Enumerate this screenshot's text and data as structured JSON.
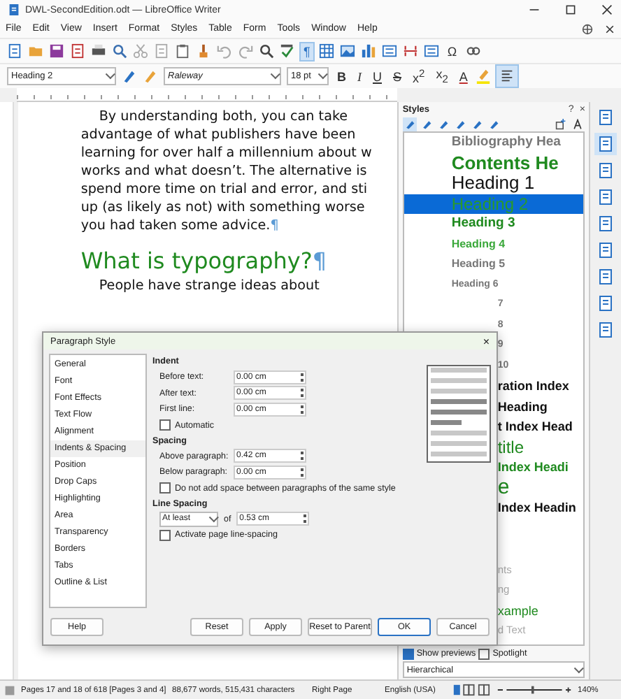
{
  "window": {
    "title": "DWL-SecondEdition.odt — LibreOffice Writer"
  },
  "menu": [
    "File",
    "Edit",
    "View",
    "Insert",
    "Format",
    "Styles",
    "Table",
    "Form",
    "Tools",
    "Window",
    "Help"
  ],
  "standard_toolbar": {
    "formatting_marks": {
      "label": "¶",
      "selected": true
    },
    "special_character": "Ω"
  },
  "formatting_toolbar": {
    "paragraph_style": "Heading 2",
    "font": "Raleway",
    "size": "18 pt",
    "buttons": [
      {
        "label": "B",
        "kind": "bold"
      },
      {
        "label": "I",
        "kind": "italic"
      },
      {
        "label": "U",
        "kind": "underline"
      },
      {
        "label": "S",
        "kind": "strike"
      },
      {
        "label": "x$^{2}$",
        "kind": "plain"
      },
      {
        "label": "x$_{2}$",
        "kind": "plain"
      },
      {
        "label": "A",
        "kind": "fontcolor"
      }
    ],
    "align_button": {
      "selected": true
    }
  },
  "document": {
    "paragraph": {
      "lines": [
        "By understanding both, you can take",
        "advantage of what publishers have been",
        "learning for over half a millennium about w",
        "works and what doesn’t. The alternative is",
        "spend more time on trial and error, and sti",
        "up (as likely as not) with something worse",
        "you had taken some advice."
      ],
      "mark": "¶"
    },
    "heading": {
      "text": "What is typography?",
      "mark": "¶"
    },
    "next_paragraph": "People have strange ideas about"
  },
  "styles_panel": {
    "title": "Styles",
    "help": "?",
    "close": "×",
    "items": [
      {
        "label": "Bibliography Hea",
        "kind": "bib",
        "selected": false
      },
      {
        "label": "Contents He",
        "kind": "contents",
        "selected": false
      },
      {
        "label": "Heading 1",
        "kind": "h1",
        "selected": false
      },
      {
        "label": "Heading 2",
        "kind": "h2",
        "selected": true
      },
      {
        "label": "Heading 3",
        "kind": "h3",
        "selected": false
      },
      {
        "label": "Heading 4",
        "kind": "h4",
        "selected": false
      },
      {
        "label": "Heading 5",
        "kind": "h5",
        "selected": false
      },
      {
        "label": "Heading 6",
        "kind": "h6",
        "selected": false
      }
    ],
    "items_behind_dialog": [
      {
        "label": "7",
        "kind": "h6"
      },
      {
        "label": "8",
        "kind": "h6"
      },
      {
        "label": "9",
        "kind": "h6"
      },
      {
        "label": "10",
        "kind": "h6"
      },
      {
        "label": "ration Index",
        "kind": "black"
      },
      {
        "label": "Heading",
        "kind": "black"
      },
      {
        "label": "t Index Head",
        "kind": "black"
      },
      {
        "label": "title",
        "kind": "subtitle"
      },
      {
        "label": "Index Headi",
        "kind": "greenbold"
      },
      {
        "label": "e",
        "kind": "title"
      },
      {
        "label": "Index Headin",
        "kind": "black"
      },
      {
        "label": "nts",
        "kind": "faint-after-gap"
      },
      {
        "label": "ng",
        "kind": "faint"
      },
      {
        "label": "xample",
        "kind": "example"
      },
      {
        "label": "d Text",
        "kind": "faint"
      }
    ],
    "show_previews": {
      "label": "Show previews",
      "checked": true
    },
    "spotlight": {
      "label": "Spotlight",
      "checked": false
    },
    "filter": "Hierarchical"
  },
  "sidebar_tabs": [
    {
      "selected": false
    },
    {
      "selected": true
    },
    {
      "selected": false
    },
    {
      "selected": false
    },
    {
      "selected": false
    },
    {
      "selected": false
    },
    {
      "selected": false
    },
    {
      "selected": false
    },
    {
      "selected": false
    }
  ],
  "dialog": {
    "title": "Paragraph Style",
    "close": "×",
    "nav": [
      {
        "label": "General",
        "selected": false
      },
      {
        "label": "Font",
        "selected": false
      },
      {
        "label": "Font Effects",
        "selected": false
      },
      {
        "label": "Text Flow",
        "selected": false
      },
      {
        "label": "Alignment",
        "selected": false
      },
      {
        "label": "Indents & Spacing",
        "selected": true
      },
      {
        "label": "Position",
        "selected": false
      },
      {
        "label": "Drop Caps",
        "selected": false
      },
      {
        "label": "Highlighting",
        "selected": false
      },
      {
        "label": "Area",
        "selected": false
      },
      {
        "label": "Transparency",
        "selected": false
      },
      {
        "label": "Borders",
        "selected": false
      },
      {
        "label": "Tabs",
        "selected": false
      },
      {
        "label": "Outline & List",
        "selected": false
      }
    ],
    "indent": {
      "heading": "Indent",
      "fields": [
        {
          "label": "Before text:",
          "value": "0.00 cm"
        },
        {
          "label": "After text:",
          "value": "0.00 cm"
        },
        {
          "label": "First line:",
          "value": "0.00 cm"
        }
      ],
      "automatic": {
        "label": "Automatic",
        "checked": false
      }
    },
    "spacing": {
      "heading": "Spacing",
      "fields": [
        {
          "label": "Above paragraph:",
          "value": "0.42 cm"
        },
        {
          "label": "Below paragraph:",
          "value": "0.00 cm"
        }
      ],
      "no_space": {
        "label": "Do not add space between paragraphs of the same style",
        "checked": false
      }
    },
    "line_spacing": {
      "heading": "Line Spacing",
      "mode": "At least",
      "of": "of",
      "value": "0.53 cm",
      "page_line_spacing": {
        "label": "Activate page line-spacing",
        "checked": false
      }
    },
    "buttons": [
      {
        "label": "Help",
        "kind": "help"
      },
      {
        "label": "Reset",
        "kind": "normal"
      },
      {
        "label": "Apply",
        "kind": "normal"
      },
      {
        "label": "Reset to Parent",
        "kind": "normal"
      },
      {
        "label": "OK",
        "kind": "default"
      },
      {
        "label": "Cancel",
        "kind": "normal"
      }
    ]
  },
  "status_bar": {
    "pages": "Pages 17 and 18 of 618 [Pages 3 and 4]",
    "words": "88,677 words, 515,431 characters",
    "page_side": "Right Page",
    "language": "English (USA)",
    "zoom_slider": {
      "level": 0.47
    },
    "zoom": "140%"
  }
}
